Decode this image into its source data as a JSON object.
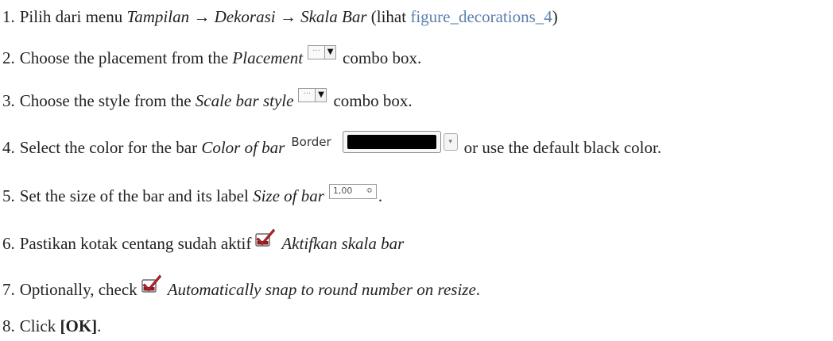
{
  "steps": [
    {
      "number": "1.",
      "text_a": "Pilih dari menu ",
      "menu_a": "Tampilan",
      "arrow_a": " → ",
      "menu_b": "Dekorasi",
      "arrow_b": " → ",
      "menu_c": "Skala Bar",
      "text_b": " (lihat ",
      "link": "figure_decorations_4",
      "text_c": ")"
    },
    {
      "number": "2.",
      "text_a": "Choose the placement from the ",
      "italic": "Placement",
      "combo_dots": "···",
      "combo_arrow": "▼",
      "text_b": "combo box."
    },
    {
      "number": "3.",
      "text_a": "Choose the style from the ",
      "italic": "Scale bar style",
      "combo_dots": "···",
      "combo_arrow": "▼",
      "text_b": "combo box."
    },
    {
      "number": "4.",
      "text_a": "Select the color for the bar ",
      "italic": "Color of bar",
      "color_label": "Border",
      "color_value": "#000000",
      "dropdown_glyph": "▾",
      "text_b": "or use the default black color."
    },
    {
      "number": "5.",
      "text_a": "Set the size of the bar and its label ",
      "italic": "Size of bar",
      "spin_value": "1,00",
      "spin_glyph": "≎",
      "text_b": "."
    },
    {
      "number": "6.",
      "text_a": "Pastikan kotak centang sudah aktif",
      "icon": "checked-checkbox-icon",
      "italic": "Aktifkan skala bar"
    },
    {
      "number": "7.",
      "text_a": "Optionally, check",
      "icon": "checked-checkbox-icon",
      "italic": "Automatically snap to round number on resize",
      "text_b": "."
    },
    {
      "number": "8.",
      "text_a": "Click ",
      "bold": "[OK]",
      "text_b": "."
    }
  ],
  "colors": {
    "link": "#5b7fb0",
    "checkbox_red": "#c0272d",
    "text": "#222222"
  }
}
